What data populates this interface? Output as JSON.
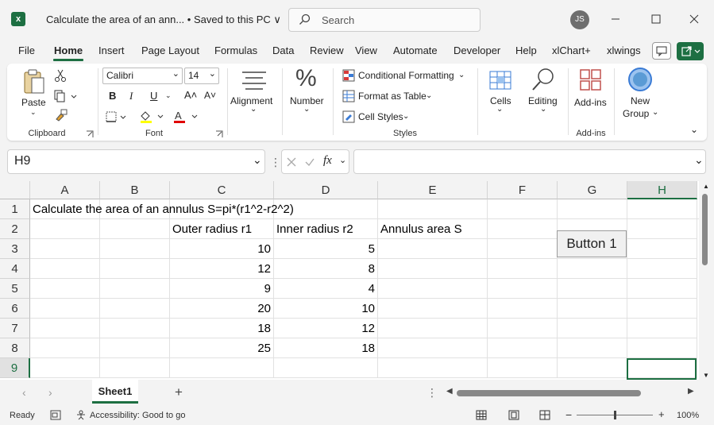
{
  "window": {
    "title": "Calculate the area of an ann...  •  Saved to this PC ∨",
    "search_placeholder": "Search",
    "user_initials": "JS"
  },
  "menu": [
    "File",
    "Home",
    "Insert",
    "Page Layout",
    "Formulas",
    "Data",
    "Review",
    "View",
    "Automate",
    "Developer",
    "Help",
    "xlChart+",
    "xlwings"
  ],
  "ribbon": {
    "clipboard": {
      "paste": "Paste",
      "label": "Clipboard"
    },
    "font": {
      "name": "Calibri",
      "size": "14",
      "bold": "B",
      "italic": "I",
      "underline": "U",
      "label": "Font"
    },
    "alignment": {
      "label": "Alignment"
    },
    "number": {
      "label": "Number"
    },
    "styles": {
      "conditional": "Conditional Formatting",
      "table": "Format as Table",
      "cell_styles": "Cell Styles",
      "label": "Styles"
    },
    "cells": {
      "label": "Cells"
    },
    "editing": {
      "label": "Editing"
    },
    "addins": {
      "button": "Add-ins",
      "label": "Add-ins"
    },
    "newgroup": {
      "line1": "New",
      "line2": "Group"
    }
  },
  "formula_bar": {
    "name_box": "H9",
    "fx": "fx",
    "formula": ""
  },
  "columns": [
    "A",
    "B",
    "C",
    "D",
    "E",
    "F",
    "G",
    "H"
  ],
  "rows": [
    "1",
    "2",
    "3",
    "4",
    "5",
    "6",
    "7",
    "8",
    "9"
  ],
  "cells": {
    "A1": "Calculate the area of an annulus  S=pi*(r1^2-r2^2)",
    "C2": "Outer radius r1",
    "D2": "Inner radius r2",
    "E2": "Annulus area S",
    "C3": "10",
    "D3": "5",
    "C4": "12",
    "D4": "8",
    "C5": "9",
    "D5": "4",
    "C6": "20",
    "D6": "10",
    "C7": "18",
    "D7": "12",
    "C8": "25",
    "D8": "18"
  },
  "selected_cell": "H9",
  "button1_label": "Button 1",
  "sheet_tab": "Sheet1",
  "status": {
    "ready": "Ready",
    "accessibility": "Accessibility: Good to go",
    "zoom": "100%"
  },
  "colors": {
    "accent": "#1d6f42"
  }
}
